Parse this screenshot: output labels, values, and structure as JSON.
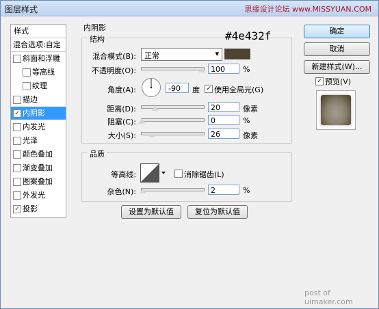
{
  "window": {
    "title": "图层样式",
    "watermark": "思缘设计论坛 www.MISSYUAN.COM",
    "close_glyph": "✕"
  },
  "sidebar": {
    "header": "样式",
    "blend_options": "混合选项:自定",
    "items": [
      {
        "label": "斜面和浮雕",
        "checked": false,
        "indent": false
      },
      {
        "label": "等高线",
        "checked": false,
        "indent": true
      },
      {
        "label": "纹理",
        "checked": false,
        "indent": true
      },
      {
        "label": "描边",
        "checked": false,
        "indent": false
      },
      {
        "label": "内阴影",
        "checked": true,
        "indent": false,
        "selected": true
      },
      {
        "label": "内发光",
        "checked": false,
        "indent": false
      },
      {
        "label": "光泽",
        "checked": false,
        "indent": false
      },
      {
        "label": "颜色叠加",
        "checked": false,
        "indent": false
      },
      {
        "label": "渐变叠加",
        "checked": false,
        "indent": false
      },
      {
        "label": "图案叠加",
        "checked": false,
        "indent": false
      },
      {
        "label": "外发光",
        "checked": false,
        "indent": false
      },
      {
        "label": "投影",
        "checked": true,
        "indent": false
      }
    ]
  },
  "panel": {
    "title": "内阴影",
    "structure": {
      "title": "结构",
      "color_annotation": "#4e432f",
      "blend_mode_label": "混合模式(B):",
      "blend_mode_value": "正常",
      "shadow_color": "#4e432f",
      "opacity_label": "不透明度(O):",
      "opacity_value": "100",
      "angle_label": "角度(A):",
      "angle_value": "-90",
      "angle_unit": "度",
      "global_light_label": "使用全局光(G)",
      "distance_label": "距离(D):",
      "distance_value": "20",
      "choke_label": "阻塞(C):",
      "choke_value": "0",
      "size_label": "大小(S):",
      "size_value": "26",
      "unit_px": "像素",
      "unit_pct": "%"
    },
    "quality": {
      "title": "品质",
      "contour_label": "等高线:",
      "antialias_label": "消除锯齿(L)",
      "noise_label": "杂色(N):",
      "noise_value": "2",
      "unit_pct": "%"
    },
    "set_default": "设置为默认值",
    "reset_default": "复位为默认值"
  },
  "actions": {
    "ok": "确定",
    "cancel": "取消",
    "new_style": "新建样式(W)...",
    "preview_label": "预览(V)"
  },
  "footer": "post of uimaker.com",
  "glyphs": {
    "check": "✓",
    "dropdown": "▾"
  }
}
